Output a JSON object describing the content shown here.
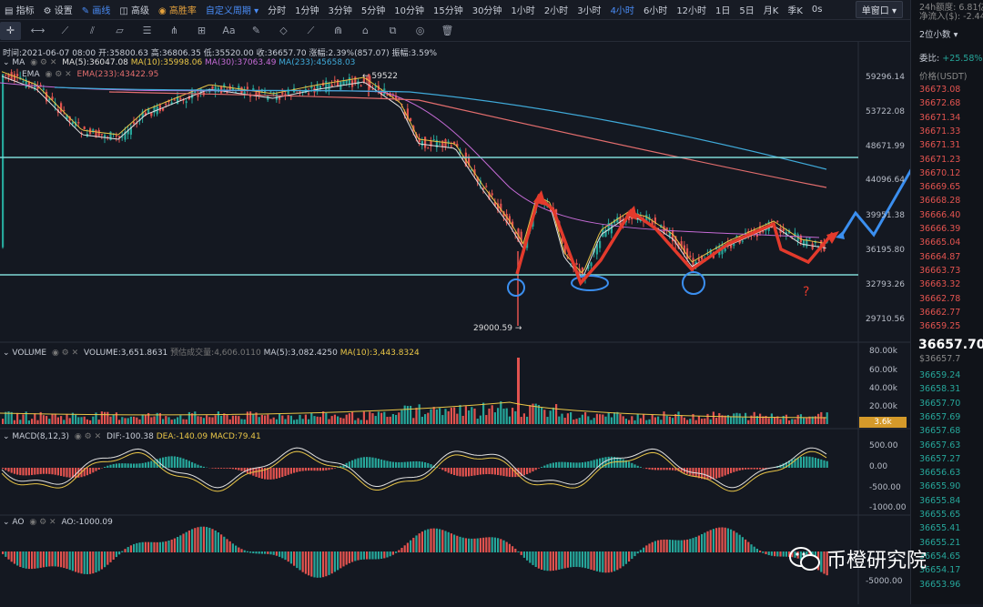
{
  "topbar": {
    "items": [
      "指标",
      "设置",
      "画线",
      "高级",
      "高胜率",
      "自定义周期",
      "分时",
      "1分钟",
      "3分钟",
      "5分钟",
      "10分钟",
      "15分钟",
      "30分钟",
      "1小时",
      "2小时",
      "3小时",
      "4小时",
      "6小时",
      "12小时",
      "1日",
      "5日",
      "月K",
      "季K",
      "0s"
    ],
    "active_index": 16,
    "window_select": "单窗口"
  },
  "info": {
    "time_label": "时间:2021-06-07 08:00",
    "open_label": "开:35800.63",
    "high_label": "高:36806.35",
    "low_label": "低:35520.00",
    "close_label": "收:36657.70",
    "chg_label": "涨幅:2.39%(857.07)",
    "amp_label": "振幅:3.59%"
  },
  "ma": {
    "name": "MA",
    "ma5": "MA(5):36047.08",
    "ma10": "MA(10):35998.06",
    "ma30": "MA(30):37063.49",
    "ma233": "MA(233):45658.03"
  },
  "ema": {
    "name": "EMA",
    "ema233": "EMA(233):43422.95"
  },
  "annot": {
    "high": "59522",
    "low": "29000.59",
    "question": "?"
  },
  "price_axis": [
    "59296.14",
    "53722.08",
    "48671.99",
    "44096.64",
    "39951.38",
    "36195.80",
    "32793.26",
    "29710.56"
  ],
  "volume": {
    "name": "VOLUME",
    "vol": "VOLUME:3,651.8631",
    "est": "预估成交量:4,606.0110",
    "ma5": "MA(5):3,082.4250",
    "ma10": "MA(10):3,443.8324",
    "axis": [
      "80.00k",
      "60.00k",
      "40.00k",
      "20.00k"
    ],
    "current": "3.6k"
  },
  "macd": {
    "name": "MACD(8,12,3)",
    "dif": "DIF:-100.38",
    "dea": "DEA:-140.09",
    "macd": "MACD:79.41",
    "axis": [
      "500.00",
      "0.00",
      "-500.00",
      "-1000.00"
    ]
  },
  "ao": {
    "name": "AO",
    "ao": "AO:-1000.09",
    "axis": [
      "-5000.00"
    ]
  },
  "right_panel": {
    "line1": "24h额度: 6.81亿",
    "line2": "净流入($): -2.44",
    "depth": "2位小数",
    "ratio_label": "委比:",
    "ratio_value": "+25.58%",
    "price_header": "价格(USDT)",
    "asks": [
      "36673.08",
      "36672.68",
      "36671.34",
      "36671.33",
      "36671.31",
      "36671.23",
      "36670.12",
      "36669.65",
      "36668.28",
      "36666.40",
      "36666.39",
      "36665.04",
      "36664.87",
      "36663.73",
      "36663.32",
      "36662.78",
      "36662.77",
      "36659.25"
    ],
    "last": "36657.70",
    "last_usd": "$36657.7",
    "bids": [
      "36659.24",
      "36658.31",
      "36657.70",
      "36657.69",
      "36657.68",
      "36657.63",
      "36657.27",
      "36656.63",
      "36655.90",
      "36655.84",
      "36655.65",
      "36655.41",
      "36655.21",
      "36654.65",
      "36654.17",
      "36653.96"
    ]
  },
  "watermark": "币橙研究院",
  "colors": {
    "up": "#26a69a",
    "down": "#e2534f",
    "bg": "#141821",
    "hline": "#7fd8d5",
    "arrow_red": "#e33a2c",
    "arrow_blue": "#3b8ff0"
  }
}
